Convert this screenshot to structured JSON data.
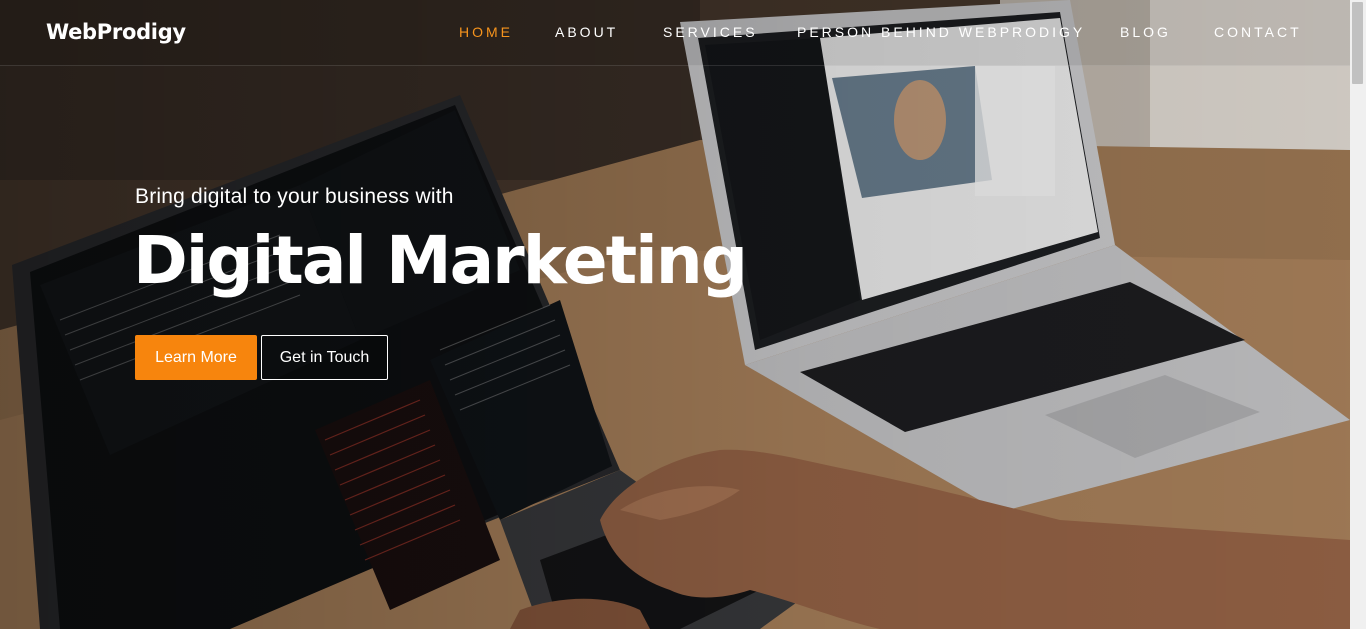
{
  "brand": {
    "logo_text": "WebProdigy"
  },
  "nav": {
    "items": [
      {
        "label": "HOME",
        "active": true
      },
      {
        "label": "ABOUT",
        "active": false
      },
      {
        "label": "SERVICES",
        "active": false
      },
      {
        "label": "PERSON BEHIND WEBPRODIGY",
        "active": false
      },
      {
        "label": "BLOG",
        "active": false
      },
      {
        "label": "CONTACT",
        "active": false
      }
    ]
  },
  "hero": {
    "subtitle": "Bring digital to your business with",
    "title": "Digital Marketing",
    "primary_button": "Learn More",
    "secondary_button": "Get in Touch"
  },
  "colors": {
    "accent": "#f7941d",
    "button_primary": "#f7850d",
    "text": "#ffffff"
  },
  "background_image": "two-laptops-on-desk-with-code-and-hands-typing"
}
